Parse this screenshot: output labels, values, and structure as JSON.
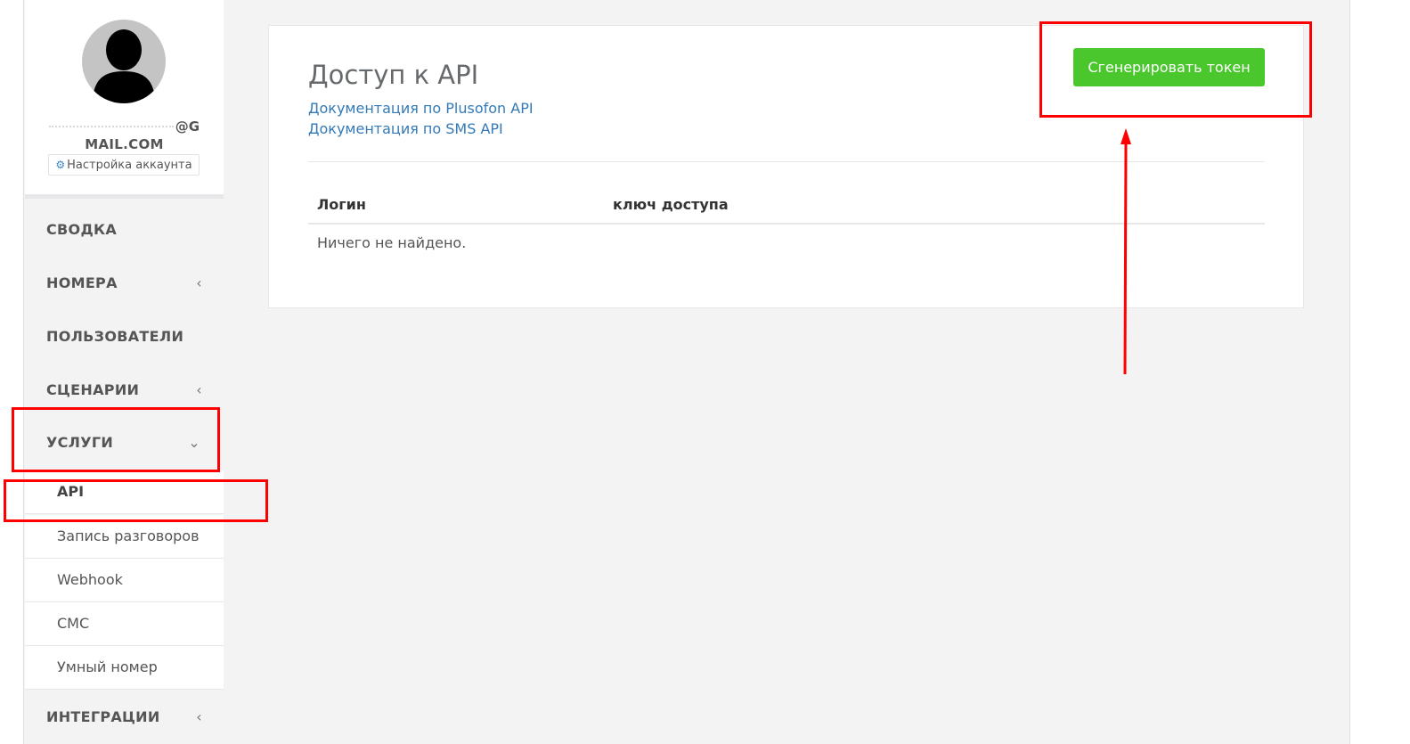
{
  "profile": {
    "email_line1": "@G",
    "email_line2": "MAIL.COM",
    "account_settings_label": "Настройка аккаунта"
  },
  "sidebar": {
    "items": [
      {
        "label": "СВОДКА",
        "chevron": ""
      },
      {
        "label": "НОМЕРА",
        "chevron": "‹"
      },
      {
        "label": "ПОЛЬЗОВАТЕЛИ",
        "chevron": ""
      },
      {
        "label": "СЦЕНАРИИ",
        "chevron": "‹"
      },
      {
        "label": "УСЛУГИ",
        "chevron": "⌄"
      },
      {
        "label": "ИНТЕГРАЦИИ",
        "chevron": "‹"
      }
    ],
    "services_sub": [
      {
        "label": "API",
        "active": true
      },
      {
        "label": "Запись разговоров"
      },
      {
        "label": "Webhook"
      },
      {
        "label": "СМС"
      },
      {
        "label": "Умный номер"
      }
    ]
  },
  "main": {
    "title": "Доступ к API",
    "links": [
      "Документация по Plusofon API",
      "Документация по SMS API"
    ],
    "generate_button": "Сгенерировать токен",
    "table": {
      "headers": [
        "Логин",
        "ключ доступа"
      ],
      "empty_text": "Ничего не найдено."
    }
  },
  "colors": {
    "accent_green": "#4bc72e",
    "link_blue": "#337ab7",
    "annotation_red": "#ff0000"
  }
}
